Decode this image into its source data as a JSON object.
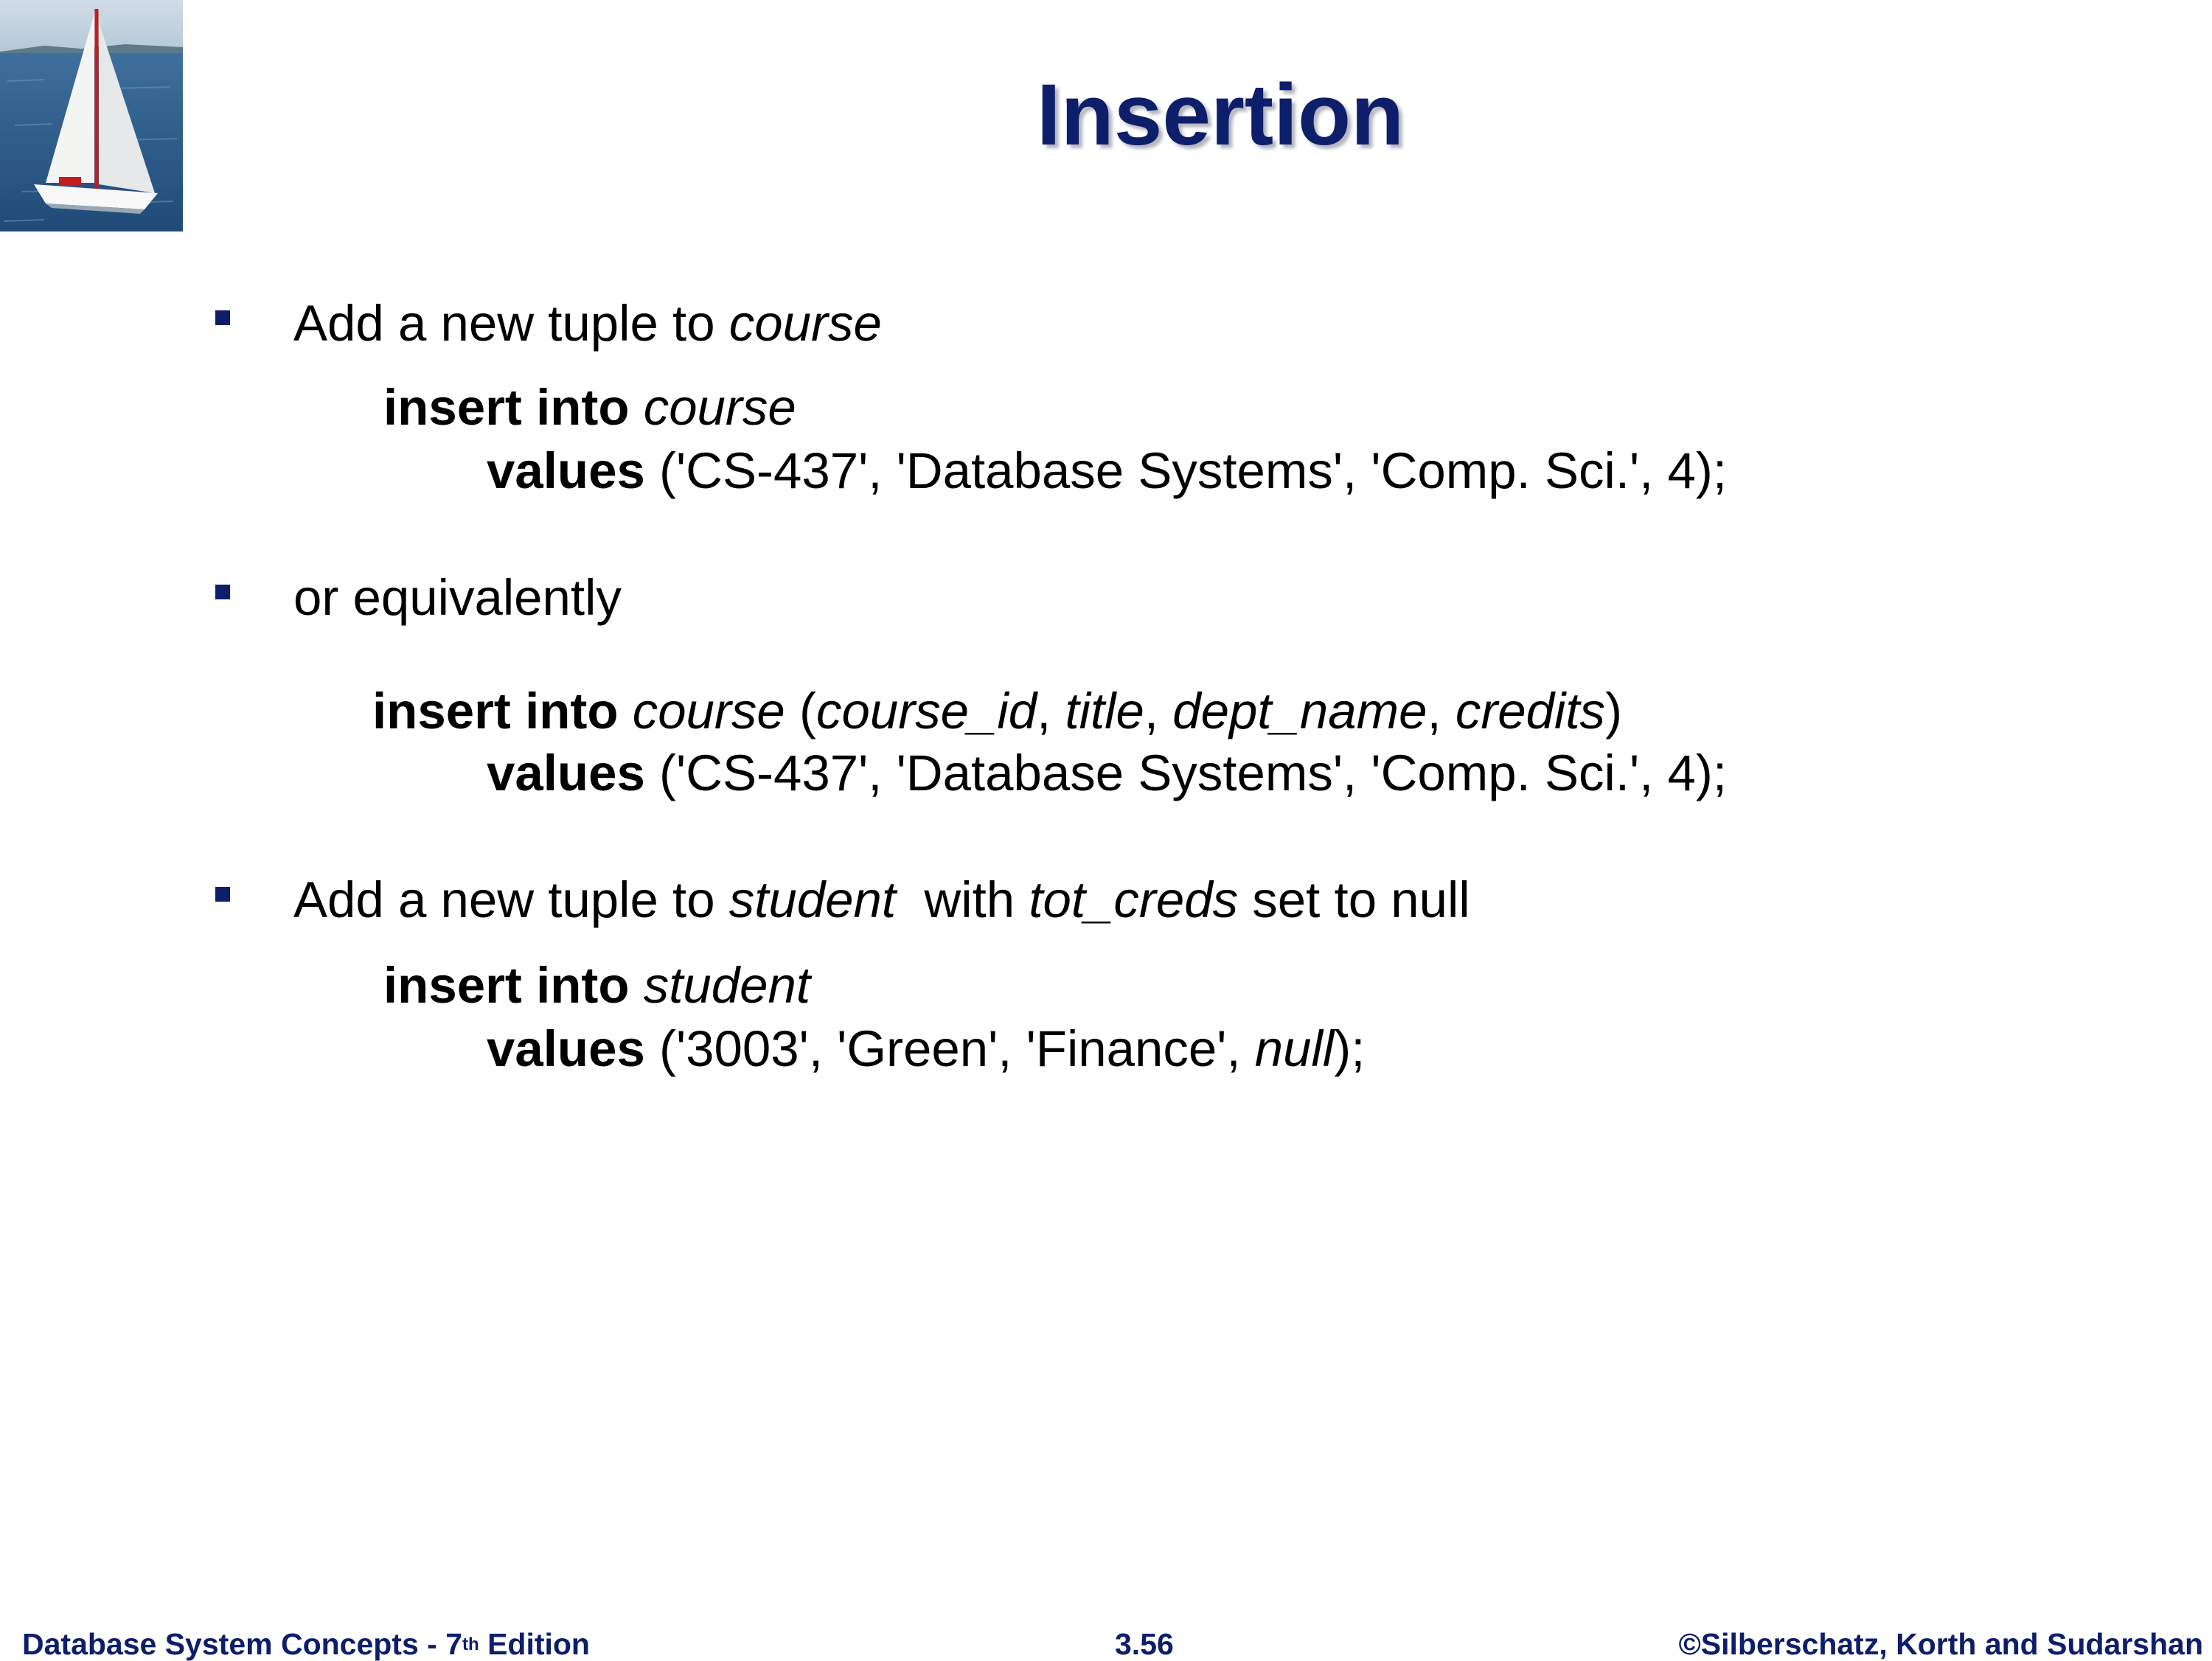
{
  "slide": {
    "title": "Insertion"
  },
  "bullets": [
    {
      "parts": [
        "Add a new tuple to ",
        "course"
      ]
    },
    {
      "parts": [
        "or equivalently"
      ]
    },
    {
      "parts": [
        "Add a new tuple to ",
        "student",
        "  with ",
        "tot_creds",
        " set to null"
      ]
    }
  ],
  "code1": {
    "kw": "insert into",
    "table": "course",
    "values_kw": "values",
    "values_rest": "('CS-437', 'Database Systems', 'Comp. Sci.', 4);"
  },
  "code2": {
    "kw": "insert into",
    "table": "course",
    "paren_open": " (",
    "cols": [
      "course_id",
      "title",
      "dept_name",
      "credits"
    ],
    "sep": ", ",
    "paren_close": ")",
    "values_kw": "values",
    "values_rest": "('CS-437', 'Database Systems', 'Comp. Sci.', 4);"
  },
  "code3": {
    "kw": "insert into",
    "table": "student",
    "values_kw": "values",
    "values_pre": "('3003', 'Green', 'Finance', ",
    "values_null": "null",
    "values_post": ");"
  },
  "footer": {
    "left_main": "Database System Concepts - 7",
    "left_sup": "th",
    "left_tail": " Edition",
    "center": "3.56",
    "right": "©Silberschatz, Korth and Sudarshan"
  },
  "colors": {
    "title": "#0d1e6b",
    "bullet": "#0d1e6b",
    "footer": "#0d1e6b"
  }
}
